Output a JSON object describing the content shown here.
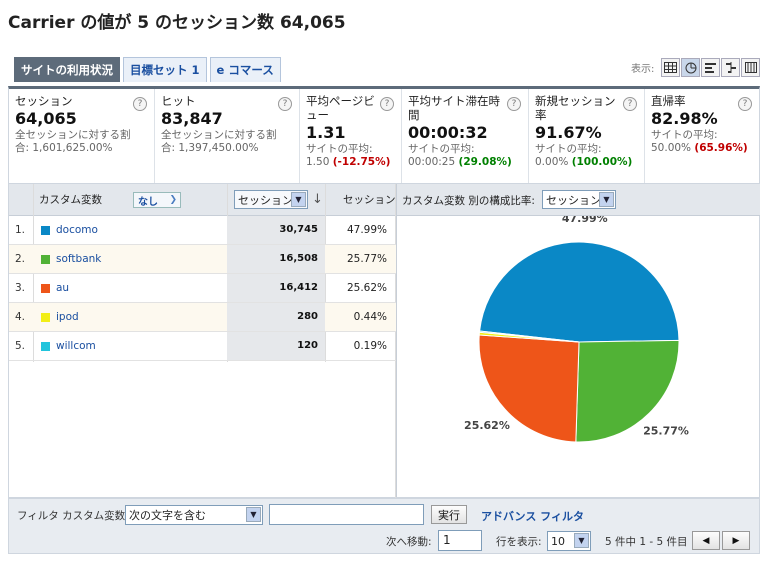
{
  "page_title": "Carrier の値が 5 のセッション数 64,065",
  "tabs": [
    {
      "label": "サイトの利用状況",
      "active": true
    },
    {
      "label": "目標セット 1",
      "active": false
    },
    {
      "label": "e コマース",
      "active": false
    }
  ],
  "display_label": "表示:",
  "view_icons": [
    "table-view-icon",
    "pie-view-icon",
    "performance-view-icon",
    "comparison-view-icon",
    "pivot-view-icon"
  ],
  "metrics": [
    {
      "label": "セッション",
      "value": "64,065",
      "sub1": "全セッションに対する割",
      "sub2": "合: 1,601,625.00%"
    },
    {
      "label": "ヒット",
      "value": "83,847",
      "sub1": "全セッションに対する割",
      "sub2": "合: 1,397,450.00%"
    },
    {
      "label": "平均ページビュー",
      "value": "1.31",
      "sub1": "サイトの平均:",
      "sub2_base": "1.50",
      "sub2_delta": "(-12.75%)",
      "delta_color": "#c00000"
    },
    {
      "label": "平均サイト滞在時間",
      "value": "00:00:32",
      "sub1": "サイトの平均:",
      "sub2_base": "00:00:25",
      "sub2_delta": "(29.08%)",
      "delta_color": "#008000"
    },
    {
      "label": "新規セッション率",
      "value": "91.67%",
      "sub1": "サイトの平均:",
      "sub2_base": "0.00%",
      "sub2_delta": "(100.00%)",
      "delta_color": "#008000"
    },
    {
      "label": "直帰率",
      "value": "82.98%",
      "sub1": "サイトの平均:",
      "sub2_base": "50.00%",
      "sub2_delta": "(65.96%)",
      "delta_color": "#c00000"
    }
  ],
  "table": {
    "col_dimension": "カスタム変数",
    "secondary_dimension": "なし",
    "sort_select": "セッション",
    "col_sessions": "セッション",
    "rows": [
      {
        "num": "1.",
        "name": "docomo",
        "color": "#0a88c6",
        "sessions": "30,745",
        "pct": "47.99%"
      },
      {
        "num": "2.",
        "name": "softbank",
        "color": "#51b236",
        "sessions": "16,508",
        "pct": "25.77%"
      },
      {
        "num": "3.",
        "name": "au",
        "color": "#ee5519",
        "sessions": "16,412",
        "pct": "25.62%"
      },
      {
        "num": "4.",
        "name": "ipod",
        "color": "#f2ee16",
        "sessions": "280",
        "pct": "0.44%"
      },
      {
        "num": "5.",
        "name": "willcom",
        "color": "#21c4dc",
        "sessions": "120",
        "pct": "0.19%"
      }
    ]
  },
  "chart_header": {
    "label": "カスタム変数 別の構成比率:",
    "select": "セッション"
  },
  "chart_data": {
    "type": "pie",
    "categories": [
      "docomo",
      "softbank",
      "au",
      "ipod",
      "willcom"
    ],
    "values": [
      47.99,
      25.77,
      25.62,
      0.44,
      0.19
    ],
    "colors": [
      "#0a88c6",
      "#51b236",
      "#ee5519",
      "#f2ee16",
      "#21c4dc"
    ],
    "data_labels": [
      "47.99%",
      "25.77%",
      "25.62%",
      "",
      ""
    ]
  },
  "filter": {
    "label": "フィルタ カスタム変数:",
    "condition": "次の文字を含む",
    "value": "",
    "run_button": "実行",
    "advanced_link": "アドバンス フィルタ",
    "goto_label": "次へ移動:",
    "goto_value": "1",
    "rows_label": "行を表示:",
    "rows_value": "10",
    "range_text": "5 件中 1 - 5 件目"
  }
}
